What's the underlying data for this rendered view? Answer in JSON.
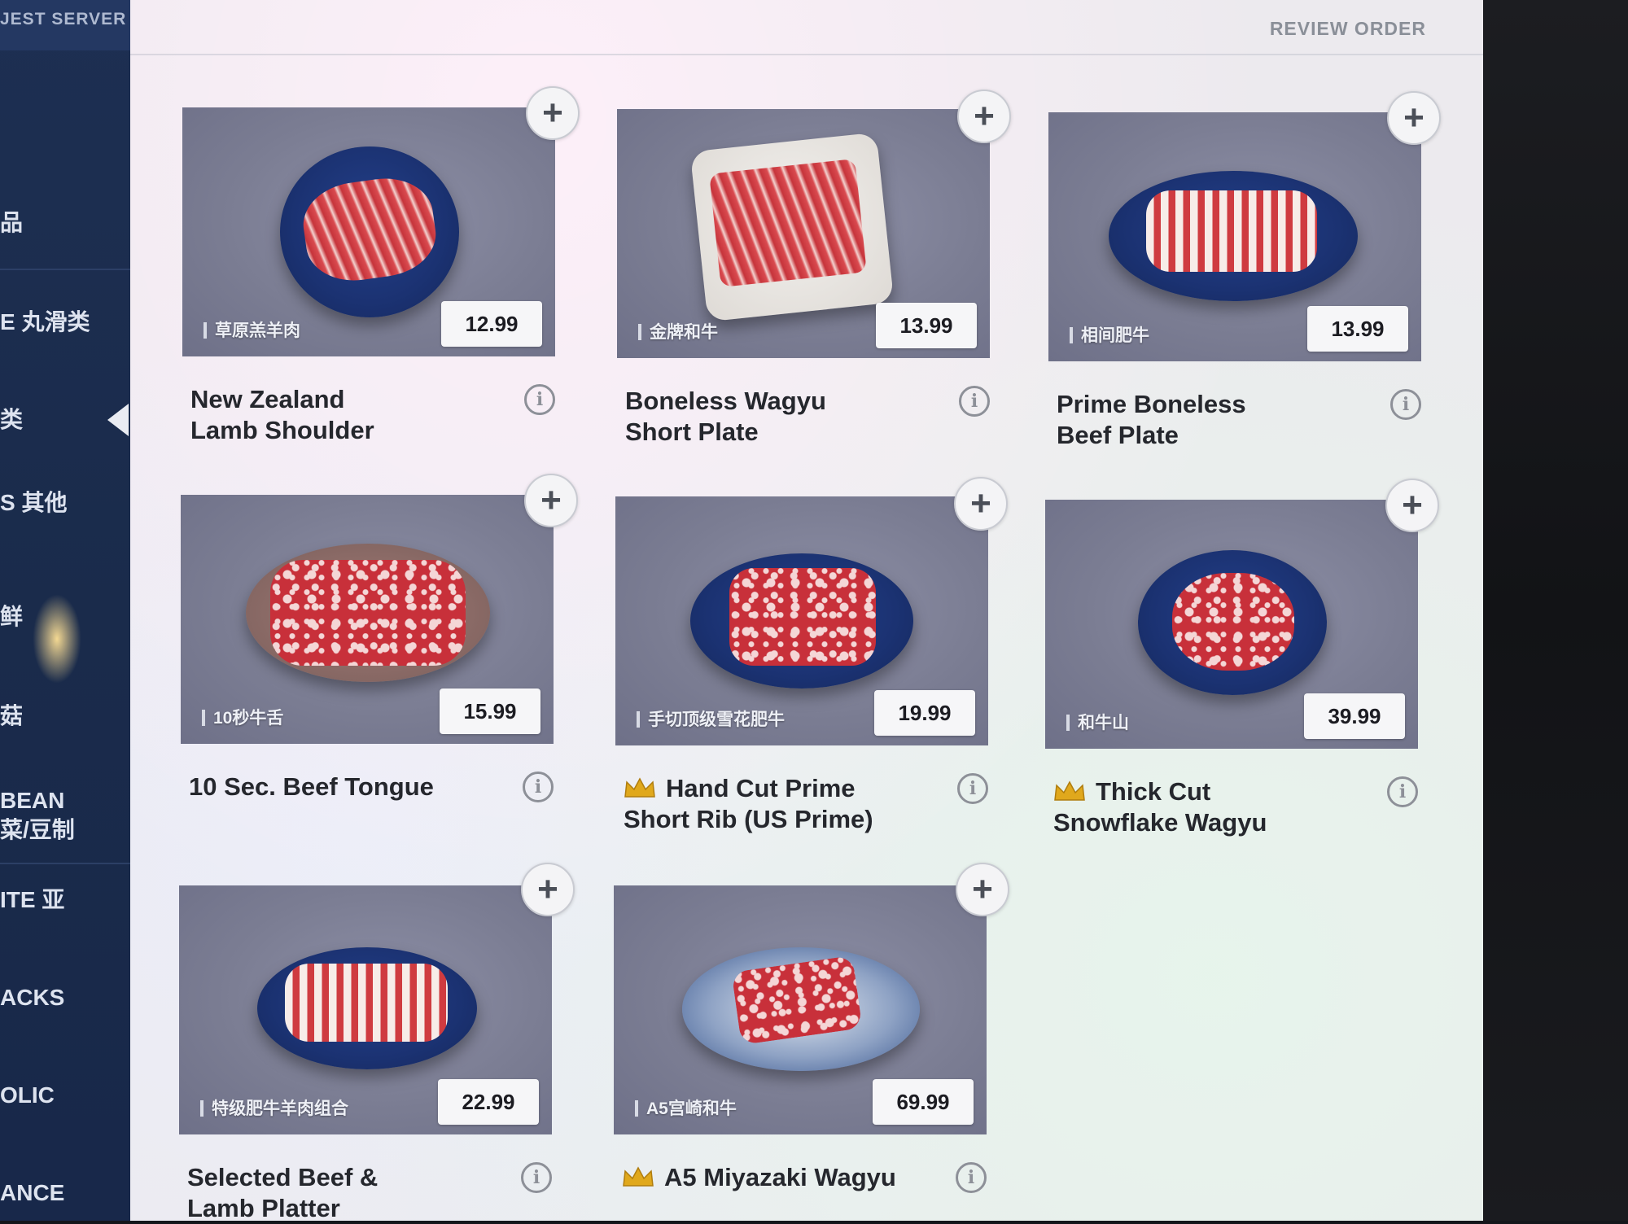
{
  "sidebar": {
    "header": "JEST SERVER",
    "items": [
      {
        "label": "品"
      },
      {
        "label": "E 丸滑类"
      },
      {
        "label": "类",
        "active": true
      },
      {
        "label": "S 其他"
      },
      {
        "label": "鲜"
      },
      {
        "label": "菇"
      },
      {
        "label": "BEAN"
      },
      {
        "label": "菜/豆制"
      },
      {
        "label": "ITE 亚"
      },
      {
        "label": "ACKS"
      },
      {
        "label": "OLIC"
      },
      {
        "label": "ANCE"
      }
    ]
  },
  "header": {
    "review_order": "REVIEW ORDER"
  },
  "add_symbol": "+",
  "info_symbol": "i",
  "items": [
    {
      "zh": "草原羔羊肉",
      "price": "12.99",
      "name_line1": "New Zealand",
      "name_line2": "Lamb Shoulder",
      "crown": false
    },
    {
      "zh": "金牌和牛",
      "price": "13.99",
      "name_line1": "Boneless Wagyu",
      "name_line2": "Short Plate",
      "crown": false
    },
    {
      "zh": "相间肥牛",
      "price": "13.99",
      "name_line1": "Prime Boneless",
      "name_line2": "Beef Plate",
      "crown": false
    },
    {
      "zh": "10秒牛舌",
      "price": "15.99",
      "name_line1": "10 Sec. Beef Tongue",
      "name_line2": "",
      "crown": false
    },
    {
      "zh": "手切顶级雪花肥牛",
      "price": "19.99",
      "name_line1": "Hand Cut Prime",
      "name_line2": "Short Rib (US Prime)",
      "crown": true
    },
    {
      "zh": "和牛山",
      "price": "39.99",
      "name_line1": "Thick Cut",
      "name_line2": "Snowflake Wagyu",
      "crown": true
    },
    {
      "zh": "特级肥牛羊肉组合",
      "price": "22.99",
      "name_line1": "Selected Beef &",
      "name_line2": "Lamb Platter",
      "crown": false
    },
    {
      "zh": "A5宫崎和牛",
      "price": "69.99",
      "name_line1": "A5 Miyazaki Wagyu",
      "name_line2": "",
      "crown": true
    }
  ],
  "colors": {
    "sidebar": "#1d2f52",
    "price_bg": "#f6f6f8",
    "crown": "#e0a81c"
  }
}
